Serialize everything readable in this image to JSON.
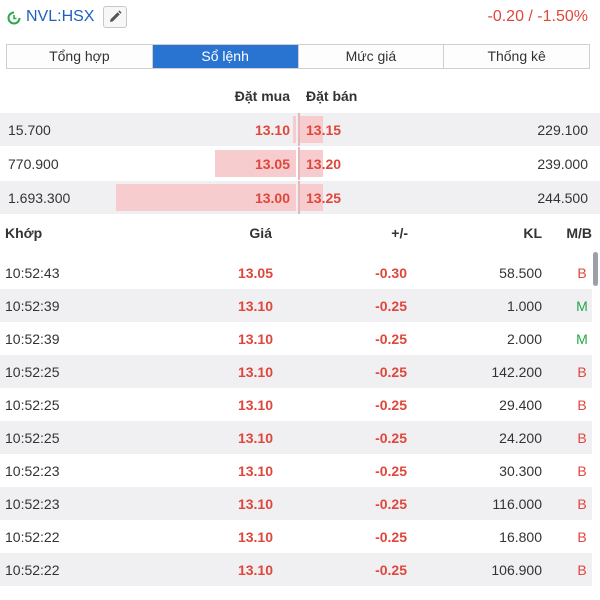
{
  "header": {
    "ticker": "NVL:HSX",
    "change": "-0.20 / -1.50%"
  },
  "tabs": [
    {
      "label": "Tổng hợp"
    },
    {
      "label": "Sổ lệnh"
    },
    {
      "label": "Mức giá"
    },
    {
      "label": "Thống kê"
    }
  ],
  "orderbook": {
    "bid_header": "Đặt mua",
    "ask_header": "Đặt bán",
    "rows": [
      {
        "bid_vol": "15.700",
        "bid_price": "13.10",
        "ask_price": "13.15",
        "ask_vol": "229.100",
        "bid_level": 0.01,
        "ask_level": 0.09
      },
      {
        "bid_vol": "770.900",
        "bid_price": "13.05",
        "ask_price": "13.20",
        "ask_vol": "239.000",
        "bid_level": 0.45,
        "ask_level": 0.09
      },
      {
        "bid_vol": "1.693.300",
        "bid_price": "13.00",
        "ask_price": "13.25",
        "ask_vol": "244.500",
        "bid_level": 1.0,
        "ask_level": 0.09
      }
    ]
  },
  "trades": {
    "headers": {
      "time": "Khớp",
      "price": "Giá",
      "change": "+/-",
      "volume": "KL",
      "side": "M/B"
    },
    "rows": [
      {
        "time": "10:52:43",
        "price": "13.05",
        "change": "-0.30",
        "volume": "58.500",
        "side": "B"
      },
      {
        "time": "10:52:39",
        "price": "13.10",
        "change": "-0.25",
        "volume": "1.000",
        "side": "M"
      },
      {
        "time": "10:52:39",
        "price": "13.10",
        "change": "-0.25",
        "volume": "2.000",
        "side": "M"
      },
      {
        "time": "10:52:25",
        "price": "13.10",
        "change": "-0.25",
        "volume": "142.200",
        "side": "B"
      },
      {
        "time": "10:52:25",
        "price": "13.10",
        "change": "-0.25",
        "volume": "29.400",
        "side": "B"
      },
      {
        "time": "10:52:25",
        "price": "13.10",
        "change": "-0.25",
        "volume": "24.200",
        "side": "B"
      },
      {
        "time": "10:52:23",
        "price": "13.10",
        "change": "-0.25",
        "volume": "30.300",
        "side": "B"
      },
      {
        "time": "10:52:23",
        "price": "13.10",
        "change": "-0.25",
        "volume": "116.000",
        "side": "B"
      },
      {
        "time": "10:52:22",
        "price": "13.10",
        "change": "-0.25",
        "volume": "16.800",
        "side": "B"
      },
      {
        "time": "10:52:22",
        "price": "13.10",
        "change": "-0.25",
        "volume": "106.900",
        "side": "B"
      }
    ]
  }
}
